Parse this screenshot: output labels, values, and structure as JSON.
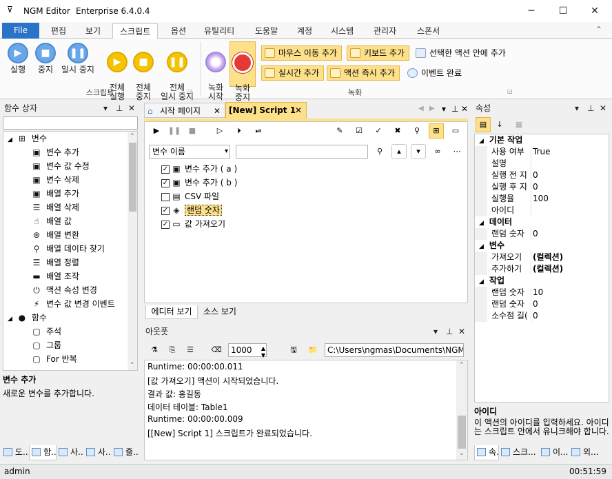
{
  "window": {
    "title": "NGM Editor",
    "subtitle": "Enterprise 6.4.0.4",
    "minimize": "─",
    "maximize": "☐",
    "close": "✕",
    "menu_glyph": "⊽"
  },
  "ribbon_tabs": [
    "File",
    "편집",
    "보기",
    "스크립트",
    "옵션",
    "유틸리티",
    "도움말",
    "계정",
    "시스템",
    "관리자",
    "스폰서"
  ],
  "ribbon": {
    "script_group": {
      "label": "스크립트",
      "buttons": [
        {
          "label": "실행",
          "icon": "play-icon"
        },
        {
          "label": "중지",
          "icon": "stop-icon"
        },
        {
          "label": "일시 중지",
          "icon": "pause-icon"
        },
        {
          "label": "전체\n실행",
          "icon": "play-all-icon"
        },
        {
          "label": "전체\n중지",
          "icon": "stop-all-icon"
        },
        {
          "label": "전체\n일시 중지",
          "icon": "pause-all-icon"
        }
      ]
    },
    "record_group": {
      "label": "녹화",
      "start": "녹화\n시작",
      "stop": "녹화\n중지",
      "small": [
        "마우스 이동 추가",
        "키보드 추가",
        "선택한 액션 안에 추가",
        "실시간 추가",
        "액션 즉시 추가",
        "이벤트 완료"
      ]
    }
  },
  "left_panel": {
    "title": "함수 상자",
    "search_value": "",
    "categories": [
      {
        "label": "변수",
        "items": [
          "변수 추가",
          "변수 값 수정",
          "변수 삭제",
          "배열 추가",
          "배열 삭제",
          "배열 값",
          "배열 변환",
          "배열 데이타 찾기",
          "배열 정렬",
          "배열 조작",
          "액션 속성 변경",
          "변수 값 변경 이벤트"
        ]
      },
      {
        "label": "함수",
        "items": [
          "주석",
          "그룹",
          "For 반복"
        ]
      }
    ],
    "desc_title": "변수 추가",
    "desc_text": "새로운 변수를 추가합니다.",
    "bottom_tabs": [
      "도...",
      "함...",
      "사...",
      "사...",
      "즐..."
    ]
  },
  "editor": {
    "tabs": [
      "시작 페이지",
      "[New] Script 1"
    ],
    "filter_select": "변수 이름",
    "filter_value": "",
    "actions": [
      {
        "label": "변수 추가 ( a )",
        "checked": true
      },
      {
        "label": "변수 추가 ( b )",
        "checked": true
      },
      {
        "label": "CSV 파일",
        "checked": false
      },
      {
        "label": "랜덤 숫자",
        "checked": true
      },
      {
        "label": "값 가져오기",
        "checked": true
      }
    ],
    "bottom_tabs": [
      "에디터 보기",
      "소스 보기"
    ]
  },
  "output": {
    "title": "아웃풋",
    "interval": "1000",
    "path": "C:\\Users\\ngmas\\Documents\\NGM6\\",
    "lines": [
      "Runtime: 00:00:00.011",
      "[값 가져오기] 액션이 시작되었습니다.",
      "결과 값: 홍길동",
      "데이터 테이블: Table1",
      "Runtime: 00:00:00.009",
      "[[New] Script 1] 스크립트가 완료되었습니다."
    ]
  },
  "props": {
    "title": "속성",
    "sections": [
      {
        "label": "기본 작업",
        "rows": [
          [
            "사용 여부",
            "True"
          ],
          [
            "설명",
            ""
          ],
          [
            "실행 전 지",
            "0"
          ],
          [
            "실행 후 지",
            "0"
          ],
          [
            "실행율",
            "100"
          ],
          [
            "아이디",
            ""
          ]
        ]
      },
      {
        "label": "데이터",
        "rows": [
          [
            "랜덤 숫자",
            "0"
          ]
        ]
      },
      {
        "label": "변수",
        "rows": [
          [
            "가져오기",
            "(컬렉션)"
          ],
          [
            "추가하기",
            "(컬렉션)"
          ]
        ]
      },
      {
        "label": "작업",
        "rows": [
          [
            "랜덤 숫자",
            "10"
          ],
          [
            "랜덤 숫자",
            "0"
          ],
          [
            "소수점 길(",
            "0"
          ]
        ]
      }
    ],
    "desc_title": "아이디",
    "desc_text": "이 액션의 아이디를 입력하세요. 아이디는 스크립트 안에서 유니크해야 합니다.",
    "bottom_tabs": [
      "속...",
      "스크...",
      "이...",
      "외..."
    ]
  },
  "status": {
    "user": "admin",
    "time": "00:51:59"
  }
}
